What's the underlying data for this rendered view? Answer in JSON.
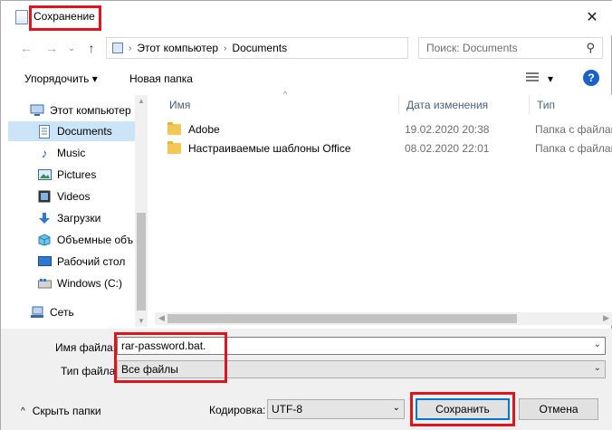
{
  "window": {
    "title": "Сохранение",
    "close_glyph": "✕"
  },
  "nav": {
    "back_glyph": "←",
    "forward_glyph": "→",
    "up_glyph": "↑",
    "chevron": "›",
    "address": [
      "Этот компьютер",
      "Documents"
    ],
    "search_placeholder": "Поиск: Documents"
  },
  "toolbar": {
    "organize": "Упорядочить ▾",
    "new_folder": "Новая папка",
    "view_dd": "▾",
    "help": "?"
  },
  "sidebar": {
    "items": [
      {
        "label": "Этот компьютер",
        "icon": "computer-icon"
      },
      {
        "label": "Documents",
        "icon": "documents-icon",
        "selected": true
      },
      {
        "label": "Music",
        "icon": "music-icon"
      },
      {
        "label": "Pictures",
        "icon": "pictures-icon"
      },
      {
        "label": "Videos",
        "icon": "videos-icon"
      },
      {
        "label": "Загрузки",
        "icon": "downloads-icon"
      },
      {
        "label": "Объемные объ",
        "icon": "3d-objects-icon"
      },
      {
        "label": "Рабочий стол",
        "icon": "desktop-icon"
      },
      {
        "label": "Windows (C:)",
        "icon": "drive-icon"
      },
      {
        "label": "Сеть",
        "icon": "network-icon"
      }
    ]
  },
  "columns": {
    "name": "Имя",
    "date": "Дата изменения",
    "type": "Тип"
  },
  "files": [
    {
      "name": "Adobe",
      "date": "19.02.2020 20:38",
      "type": "Папка с файлами"
    },
    {
      "name": "Настраиваемые шаблоны Office",
      "date": "08.02.2020 22:01",
      "type": "Папка с файлами"
    }
  ],
  "form": {
    "filename_label": "Имя файла:",
    "filename_value": "rar-password.bat.",
    "filetype_label": "Тип файла:",
    "filetype_value": "Все файлы"
  },
  "bottom": {
    "hide_folders": "Скрыть папки",
    "encoding_label": "Кодировка:",
    "encoding_value": "UTF-8",
    "save": "Сохранить",
    "cancel": "Отмена"
  },
  "colors": {
    "highlight": "#e0141e",
    "selection": "#cce4f7",
    "primary_border": "#0078d7"
  }
}
